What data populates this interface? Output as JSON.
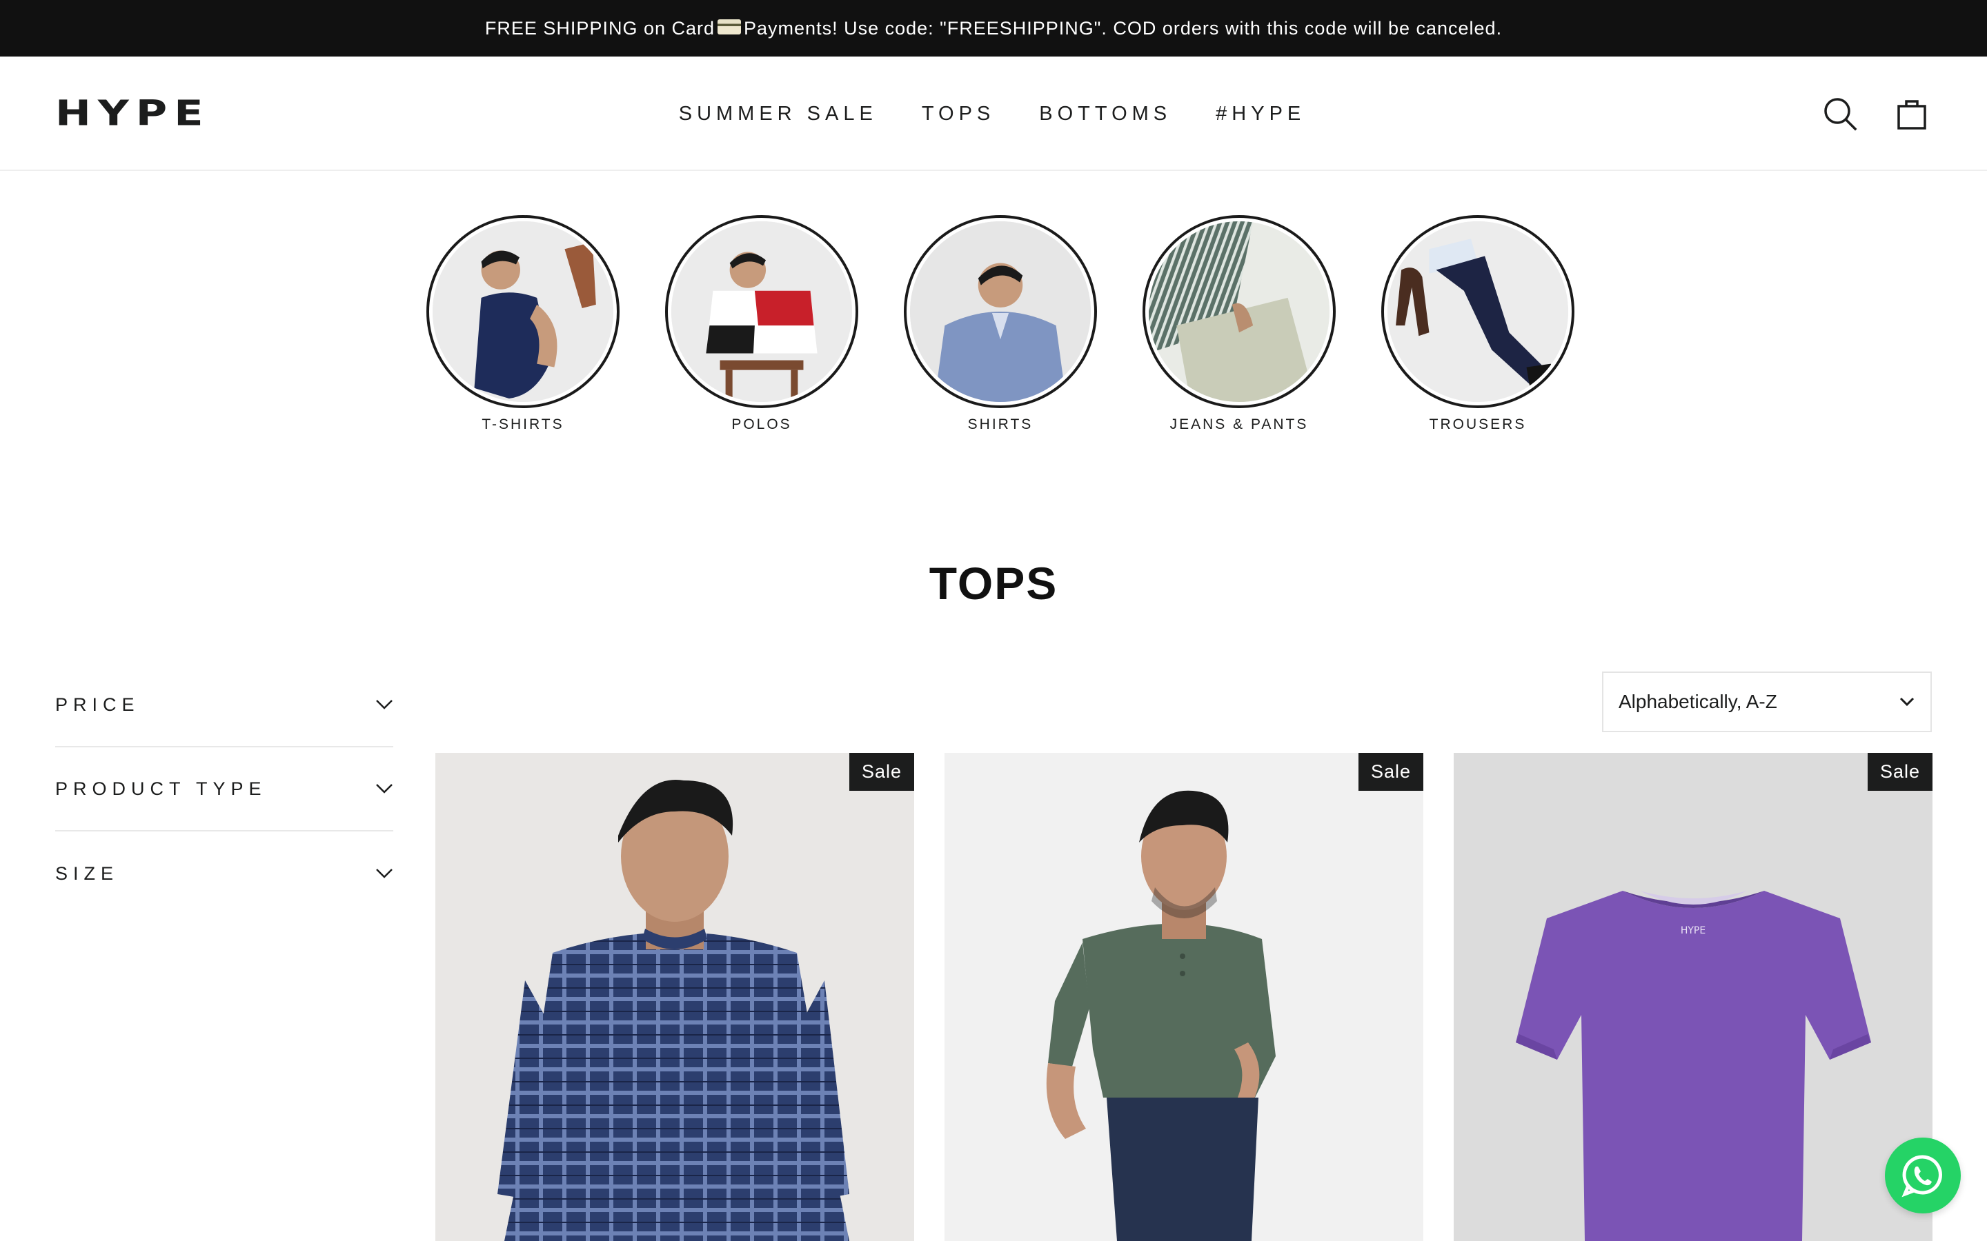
{
  "announcement": {
    "text_before": "FREE SHIPPING on Card",
    "text_after": " Payments! Use code: \"FREESHIPPING\". COD orders with this code will be canceled."
  },
  "header": {
    "logo": "HYPE",
    "nav": [
      "SUMMER SALE",
      "TOPS",
      "BOTTOMS",
      "#HYPE"
    ],
    "icons": [
      "search-icon",
      "cart-bag-icon"
    ]
  },
  "collections": [
    {
      "label": "T-SHIRTS"
    },
    {
      "label": "POLOS"
    },
    {
      "label": "SHIRTS"
    },
    {
      "label": "JEANS & PANTS"
    },
    {
      "label": "TROUSERS"
    }
  ],
  "page_title": "TOPS",
  "filters": [
    {
      "label": "PRICE"
    },
    {
      "label": "PRODUCT TYPE"
    },
    {
      "label": "SIZE"
    }
  ],
  "sort": {
    "selected": "Alphabetically, A-Z"
  },
  "products": [
    {
      "badge": "Sale"
    },
    {
      "badge": "Sale"
    },
    {
      "badge": "Sale"
    }
  ],
  "colors": {
    "announcement_bg": "#111111",
    "text": "#1c1d1d",
    "sale_badge_bg": "#1c1d1d",
    "whatsapp": "#25d366"
  }
}
